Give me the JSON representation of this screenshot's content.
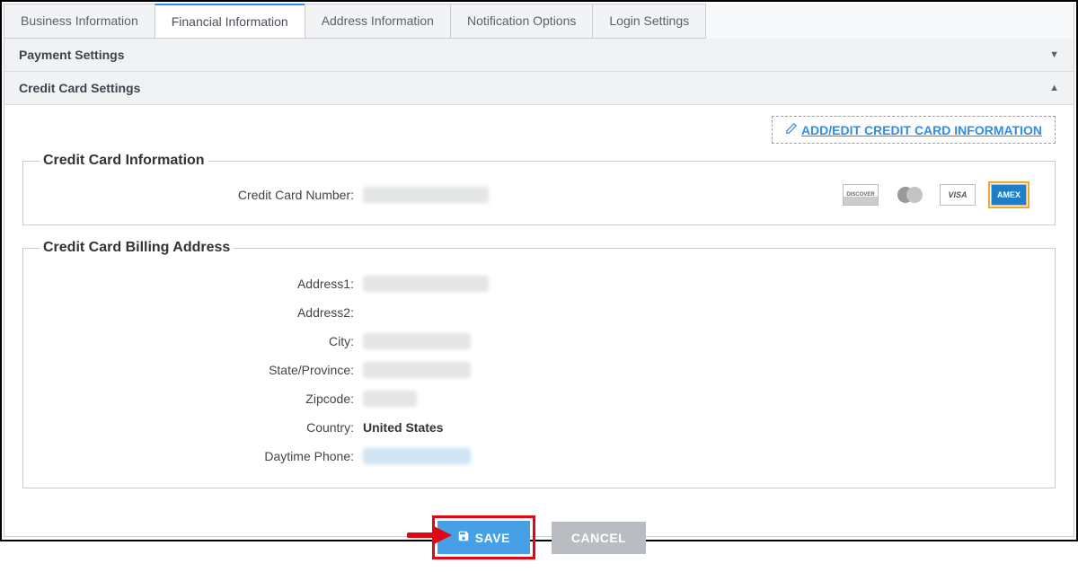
{
  "tabs": {
    "business": "Business Information",
    "financial": "Financial Information",
    "address": "Address Information",
    "notification": "Notification Options",
    "login": "Login Settings"
  },
  "accordion": {
    "payment_settings": "Payment Settings",
    "credit_card_settings": "Credit Card Settings"
  },
  "addedit_label": "ADD/EDIT CREDIT CARD INFORMATION",
  "cc_info": {
    "legend": "Credit Card Information",
    "number_label": "Credit Card Number:",
    "cards": {
      "discover": "DISCOVER",
      "mastercard": "MasterCard",
      "visa": "VISA",
      "amex": "AMEX"
    }
  },
  "billing": {
    "legend": "Credit Card Billing Address",
    "address1_label": "Address1:",
    "address2_label": "Address2:",
    "city_label": "City:",
    "state_label": "State/Province:",
    "zip_label": "Zipcode:",
    "country_label": "Country:",
    "country_value": "United States",
    "phone_label": "Daytime Phone:"
  },
  "buttons": {
    "save": "SAVE",
    "cancel": "CANCEL"
  }
}
